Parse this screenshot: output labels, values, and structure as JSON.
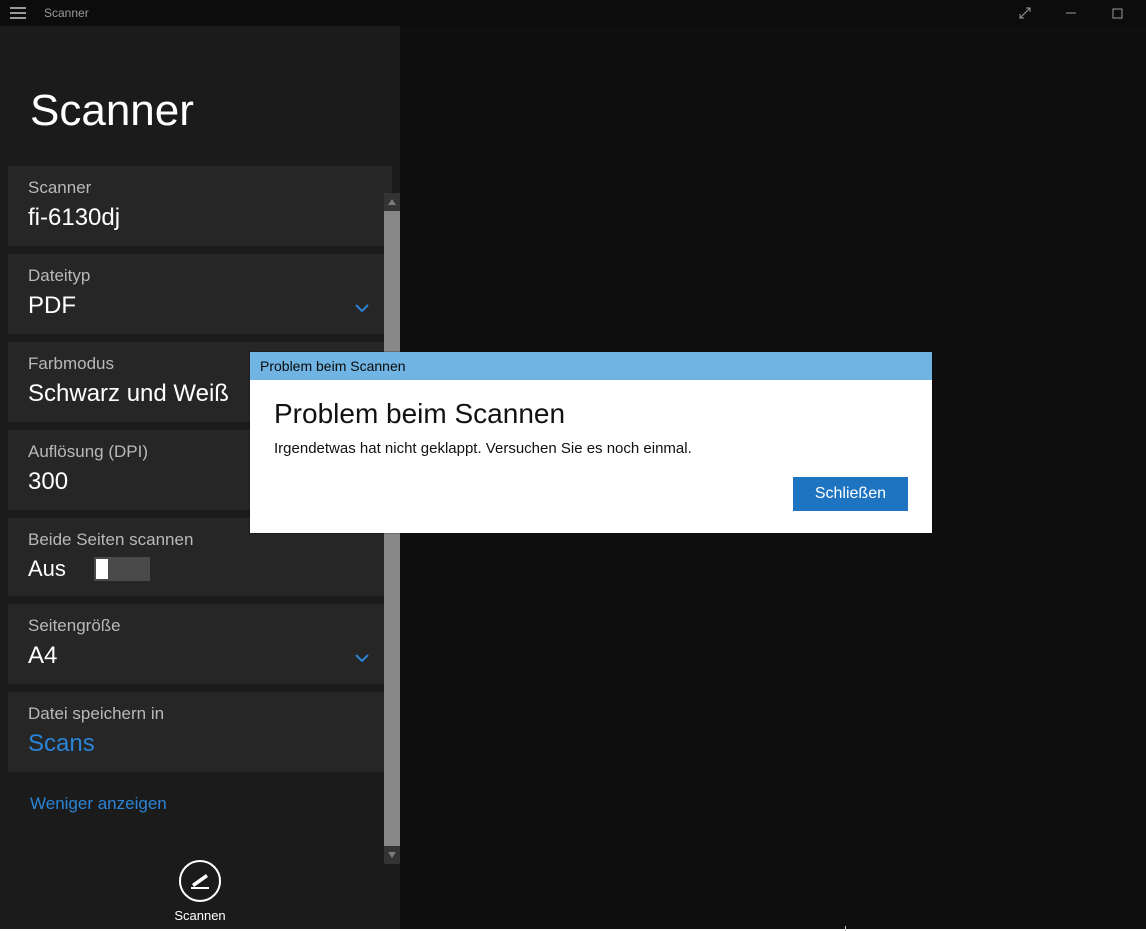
{
  "window": {
    "title": "Scanner"
  },
  "heading": "Scanner",
  "settings": {
    "scanner": {
      "label": "Scanner",
      "value": "fi-6130dj"
    },
    "file_type": {
      "label": "Dateityp",
      "value": "PDF"
    },
    "color_mode": {
      "label": "Farbmodus",
      "value": "Schwarz und Weiß"
    },
    "resolution": {
      "label": "Auflösung (DPI)",
      "value": "300"
    },
    "both_sides": {
      "label": "Beide Seiten scannen",
      "state": "Aus"
    },
    "page_size": {
      "label": "Seitengröße",
      "value": "A4"
    },
    "save_to": {
      "label": "Datei speichern in",
      "value": "Scans"
    }
  },
  "less_link": "Weniger anzeigen",
  "scan_button": "Scannen",
  "dialog": {
    "titlebar": "Problem beim Scannen",
    "heading": "Problem beim Scannen",
    "message": "Irgendetwas hat nicht geklappt. Versuchen Sie es noch einmal.",
    "close": "Schließen"
  }
}
